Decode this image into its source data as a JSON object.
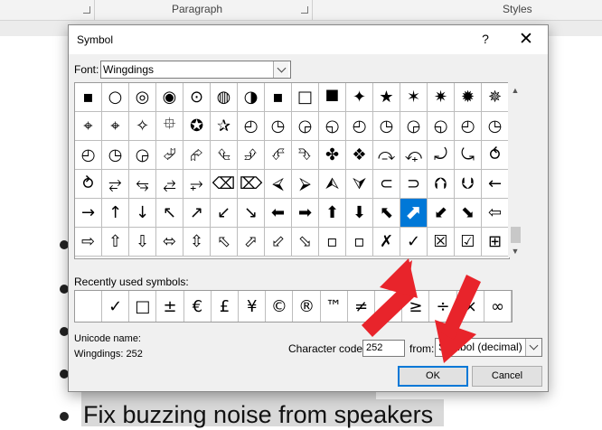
{
  "ribbon": {
    "group_paragraph": "Paragraph",
    "group_styles": "Styles"
  },
  "document": {
    "line_text": "Fix buzzing noise from speakers"
  },
  "dialog": {
    "title": "Symbol",
    "help": "?",
    "close": "✕",
    "font_label": "Font:",
    "font_value": "Wingdings",
    "recent_label": "Recently used symbols:",
    "unicode_name_label": "Unicode name:",
    "unicode_name_value": "Wingdings: 252",
    "char_code_label": "Character code:",
    "char_code_value": "252",
    "from_label": "from:",
    "from_value": "Symbol (decimal)",
    "ok": "OK",
    "cancel": "Cancel"
  },
  "symbol_grid": {
    "selected_index": 76,
    "rows": [
      [
        "▪",
        "○",
        "◎",
        "◉",
        "⊙",
        "◍",
        "◑",
        "▪",
        "□",
        "⯀",
        "✦",
        "★",
        "✶",
        "✷",
        "✹",
        "✵"
      ],
      [
        "⌖",
        "⌖",
        "✧",
        "⯐",
        "✪",
        "✰",
        "◴",
        "◷",
        "◶",
        "◵",
        "◴",
        "◷",
        "◶",
        "◵",
        "◴",
        "◷"
      ],
      [
        "◴",
        "◷",
        "◶",
        "⮰",
        "⮳",
        "⮴",
        "⮵",
        "⮶",
        "⮷",
        "✤",
        "❖",
        "⤼",
        "⤽",
        "⤾",
        "⤿",
        "⥀"
      ],
      [
        "⥁",
        "⥂",
        "⥃",
        "⥄",
        "⥅",
        "⌫",
        "⌦",
        "⮘",
        "⮚",
        "⮙",
        "⮛",
        "⊂",
        "⊃",
        "⮉",
        "⮋",
        "←"
      ],
      [
        "→",
        "↑",
        "↓",
        "↖",
        "↗",
        "↙",
        "↘",
        "⬅",
        "➡",
        "⬆",
        "⬇",
        "⬉",
        "⬈",
        "⬋",
        "⬊",
        "⇦"
      ],
      [
        "⇨",
        "⇧",
        "⇩",
        "⬄",
        "⇳",
        "⬁",
        "⬀",
        "⬃",
        "⬂",
        "▫",
        "▫",
        "✗",
        "✓",
        "☒",
        "☑",
        "⊞"
      ]
    ]
  },
  "recent_symbols": [
    "",
    "✓",
    "□",
    "±",
    "€",
    "£",
    "¥",
    "©",
    "®",
    "™",
    "≠",
    "≤",
    "≥",
    "÷",
    "×",
    "∞"
  ]
}
